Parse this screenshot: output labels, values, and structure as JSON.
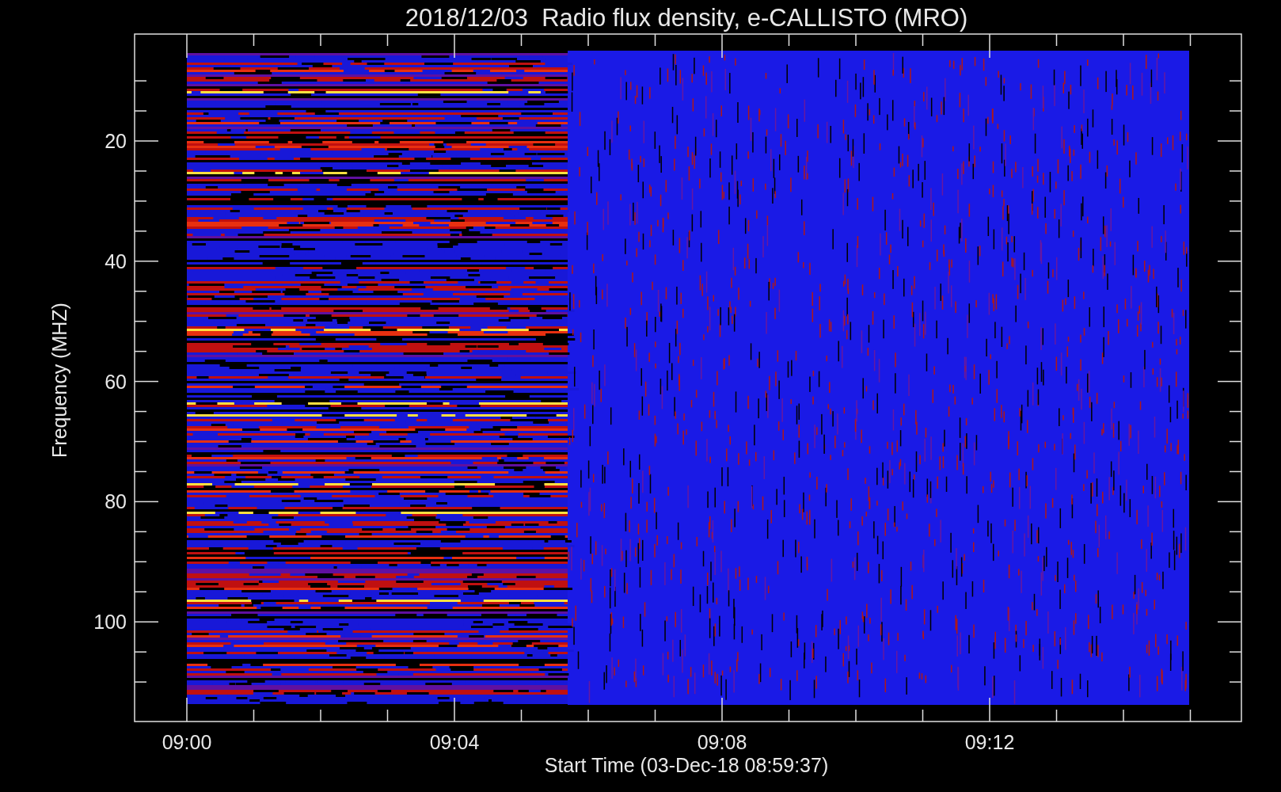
{
  "title": "2018/12/03  Radio flux density, e-CALLISTO (MRO)",
  "x_axis": {
    "label": "Start Time (03-Dec-18 08:59:37)",
    "tick_labels": [
      "09:00",
      "09:04",
      "09:08",
      "09:12"
    ]
  },
  "y_axis": {
    "label": "Frequency (MHZ)",
    "tick_labels": [
      "20",
      "40",
      "60",
      "80",
      "100"
    ]
  }
}
